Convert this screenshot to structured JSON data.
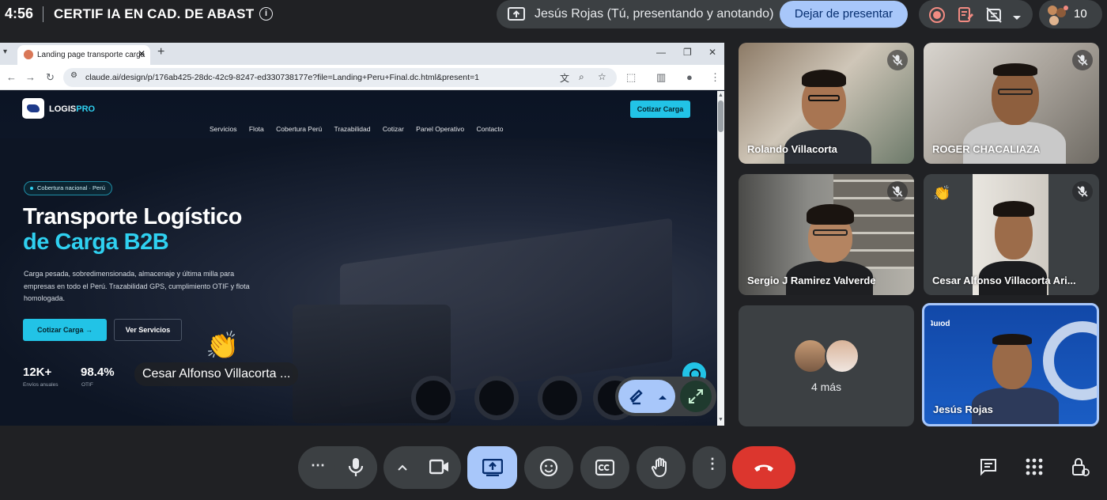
{
  "meet": {
    "time": "4:56",
    "meeting_title": "CERTIF IA EN CAD. DE ABAST",
    "presenting_text": "Jesús Rojas (Tú, presentando y anotando)",
    "stop_presenting_label": "Dejar de presentar",
    "participant_count": "10"
  },
  "browser": {
    "tab_title": "Landing page transporte carga",
    "url": "claude.ai/design/p/176ab425-28dc-42c9-8247-ed330738177e?file=Landing+Peru+Final.dc.html&present=1"
  },
  "site": {
    "logo_main": "LOGIS",
    "logo_accent": "PRO",
    "cta_top": "Cotizar Carga",
    "nav": [
      "Servicios",
      "Flota",
      "Cobertura Perú",
      "Trazabilidad",
      "Cotizar",
      "Panel Operativo",
      "Contacto"
    ],
    "badge": "Cobertura nacional · Perú",
    "headline_1": "Transporte Logístico",
    "headline_2": "de Carga B2B",
    "lead": "Carga pesada, sobredimensionada, almacenaje y última milla para empresas en todo el Perú. Trazabilidad GPS, cumplimiento OTIF y flota homologada.",
    "btn_primary": "Cotizar Carga →",
    "btn_secondary": "Ver Servicios",
    "stats": [
      {
        "value": "12K+",
        "label": "Envíos anuales"
      },
      {
        "value": "98.4%",
        "label": "OTIF"
      }
    ]
  },
  "reaction": {
    "emoji": "👏",
    "name": "Cesar Alfonso Villacorta ..."
  },
  "participants": [
    {
      "name": "Rolando Villacorta"
    },
    {
      "name": "ROGER CHACALIAZA"
    },
    {
      "name": "Sergio J Ramirez Valverde"
    },
    {
      "name": "Cesar Alfonso Villacorta Ari..."
    },
    {
      "name": "4 más"
    },
    {
      "name": "Jesús Rojas"
    }
  ],
  "colors": {
    "meet_bg": "#202124",
    "pill_bg": "#3c4043",
    "accent_blue": "#a8c7fa",
    "site_cyan": "#22c3e6",
    "end_call_red": "#dc362e"
  },
  "icons": {
    "more_options": "⋯",
    "kebab": "⋮",
    "clap": "👏"
  }
}
